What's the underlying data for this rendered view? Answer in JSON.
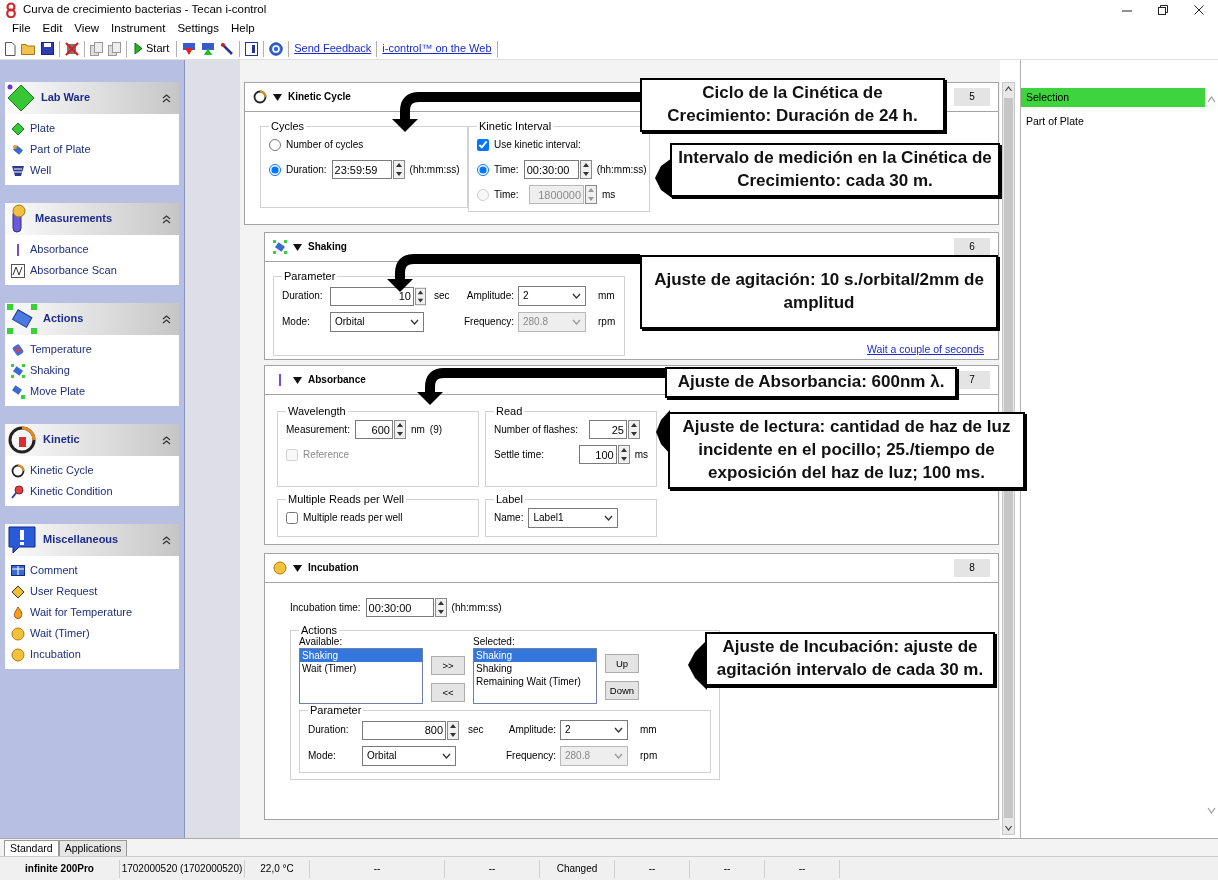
{
  "window": {
    "title": "Curva de crecimiento bacterias - Tecan i-control"
  },
  "menu": [
    "File",
    "Edit",
    "View",
    "Instrument",
    "Settings",
    "Help"
  ],
  "toolbar": {
    "start_label": "Start",
    "links": [
      "Send Feedback",
      "i-control™ on the Web"
    ]
  },
  "sidebar": {
    "groups": [
      {
        "title": "Lab Ware",
        "expanded": true,
        "items": [
          "Plate",
          "Part of Plate",
          "Well"
        ]
      },
      {
        "title": "Measurements",
        "expanded": true,
        "items": [
          "Absorbance",
          "Absorbance Scan"
        ]
      },
      {
        "title": "Actions",
        "expanded": true,
        "items": [
          "Temperature",
          "Shaking",
          "Move Plate"
        ]
      },
      {
        "title": "Kinetic",
        "expanded": true,
        "items": [
          "Kinetic Cycle",
          "Kinetic Condition"
        ]
      },
      {
        "title": "Miscellaneous",
        "expanded": true,
        "items": [
          "Comment",
          "User Request",
          "Wait for Temperature",
          "Wait (Timer)",
          "Incubation"
        ]
      }
    ]
  },
  "panels": [
    {
      "kind": "kinetic_cycle",
      "title": "Kinetic Cycle",
      "number": "5",
      "cycles": {
        "legend": "Cycles",
        "options": [
          {
            "label": "Number of cycles",
            "selected": false
          },
          {
            "label": "Duration:",
            "selected": true,
            "value": "23:59:59",
            "unit": "(hh:mm:ss)"
          }
        ]
      },
      "interval": {
        "legend": "Kinetic Interval",
        "use": {
          "label": "Use kinetic interval:",
          "checked": true
        },
        "options": [
          {
            "label": "Time:",
            "selected": true,
            "value": "00:30:00",
            "unit": "(hh:mm:ss)",
            "disabled": false
          },
          {
            "label": "Time:",
            "selected": false,
            "value": "1800000",
            "unit": "ms",
            "disabled": true
          }
        ]
      }
    },
    {
      "kind": "shaking",
      "title": "Shaking",
      "number": "6",
      "parameter": {
        "legend": "Parameter",
        "duration": {
          "label": "Duration:",
          "value": "10",
          "unit": "sec"
        },
        "mode": {
          "label": "Mode:",
          "value": "Orbital"
        },
        "amplitude": {
          "label": "Amplitude:",
          "value": "2",
          "unit": "mm"
        },
        "frequency": {
          "label": "Frequency:",
          "value": "280.8",
          "unit": "rpm",
          "disabled": true
        }
      },
      "link": "Wait a couple of seconds"
    },
    {
      "kind": "absorbance",
      "title": "Absorbance",
      "number": "7",
      "wavelength": {
        "legend": "Wavelength",
        "measurement": {
          "label": "Measurement:",
          "value": "600",
          "unit": "nm",
          "extra": "(9)"
        },
        "reference": {
          "label": "Reference",
          "checked": false,
          "disabled": true
        }
      },
      "read": {
        "legend": "Read",
        "flashes": {
          "label": "Number of flashes:",
          "value": "25"
        },
        "settle": {
          "label": "Settle time:",
          "value": "100",
          "unit": "ms"
        }
      },
      "multiple": {
        "legend": "Multiple Reads per Well",
        "checkbox": {
          "label": "Multiple reads per well",
          "checked": false,
          "disabled": false
        }
      },
      "label_group": {
        "legend": "Label",
        "name": {
          "label": "Name:",
          "value": "Label1"
        }
      }
    },
    {
      "kind": "incubation",
      "title": "Incubation",
      "number": "8",
      "time": {
        "label": "Incubation time:",
        "value": "00:30:00",
        "unit": "(hh:mm:ss)"
      },
      "actions": {
        "legend": "Actions",
        "available": {
          "label": "Available:",
          "items": [
            {
              "text": "Shaking",
              "selected": true
            },
            {
              "text": "Wait (Timer)",
              "selected": false
            }
          ]
        },
        "add_buttons": [
          ">>",
          "<<"
        ],
        "chosen": {
          "label": "Selected:",
          "items": [
            {
              "text": "Shaking",
              "selected": true
            },
            {
              "text": "Shaking",
              "selected": false
            },
            {
              "text": "Remaining Wait (Timer)",
              "selected": false
            }
          ]
        },
        "order_buttons": [
          "Up",
          "Down"
        ],
        "parameter": {
          "legend": "Parameter",
          "duration": {
            "label": "Duration:",
            "value": "800",
            "unit": "sec"
          },
          "mode": {
            "label": "Mode:",
            "value": "Orbital"
          },
          "amplitude": {
            "label": "Amplitude:",
            "value": "2",
            "unit": "mm"
          },
          "frequency": {
            "label": "Frequency:",
            "value": "280.8",
            "unit": "rpm",
            "disabled": true
          }
        }
      }
    }
  ],
  "callouts": [
    {
      "text": "Ciclo de la Cinética de Crecimiento: Duración de 24 h."
    },
    {
      "text": "Intervalo de medición en la Cinética de Crecimiento: cada 30 m."
    },
    {
      "text": "Ajuste de agitación: 10 s./orbital/2mm de amplitud"
    },
    {
      "text": "Ajuste de Absorbancia: 600nm λ."
    },
    {
      "text": "Ajuste de lectura: cantidad de haz de luz incidente en el pocillo; 25./tiempo de exposición del haz de luz; 100 ms."
    },
    {
      "text": "Ajuste de Incubación: ajuste de agitación intervalo de cada 30 m."
    }
  ],
  "selection_panel": {
    "header": "Selection",
    "items": [
      "Part of Plate"
    ]
  },
  "bottom_tabs": [
    {
      "label": "Standard",
      "selected": true
    },
    {
      "label": "Applications",
      "selected": false
    }
  ],
  "status_bar": [
    "infinite 200Pro",
    "1702000520 (1702000520)",
    "22,0 °C",
    "--",
    "--",
    "Changed",
    "--",
    "--",
    "--"
  ]
}
